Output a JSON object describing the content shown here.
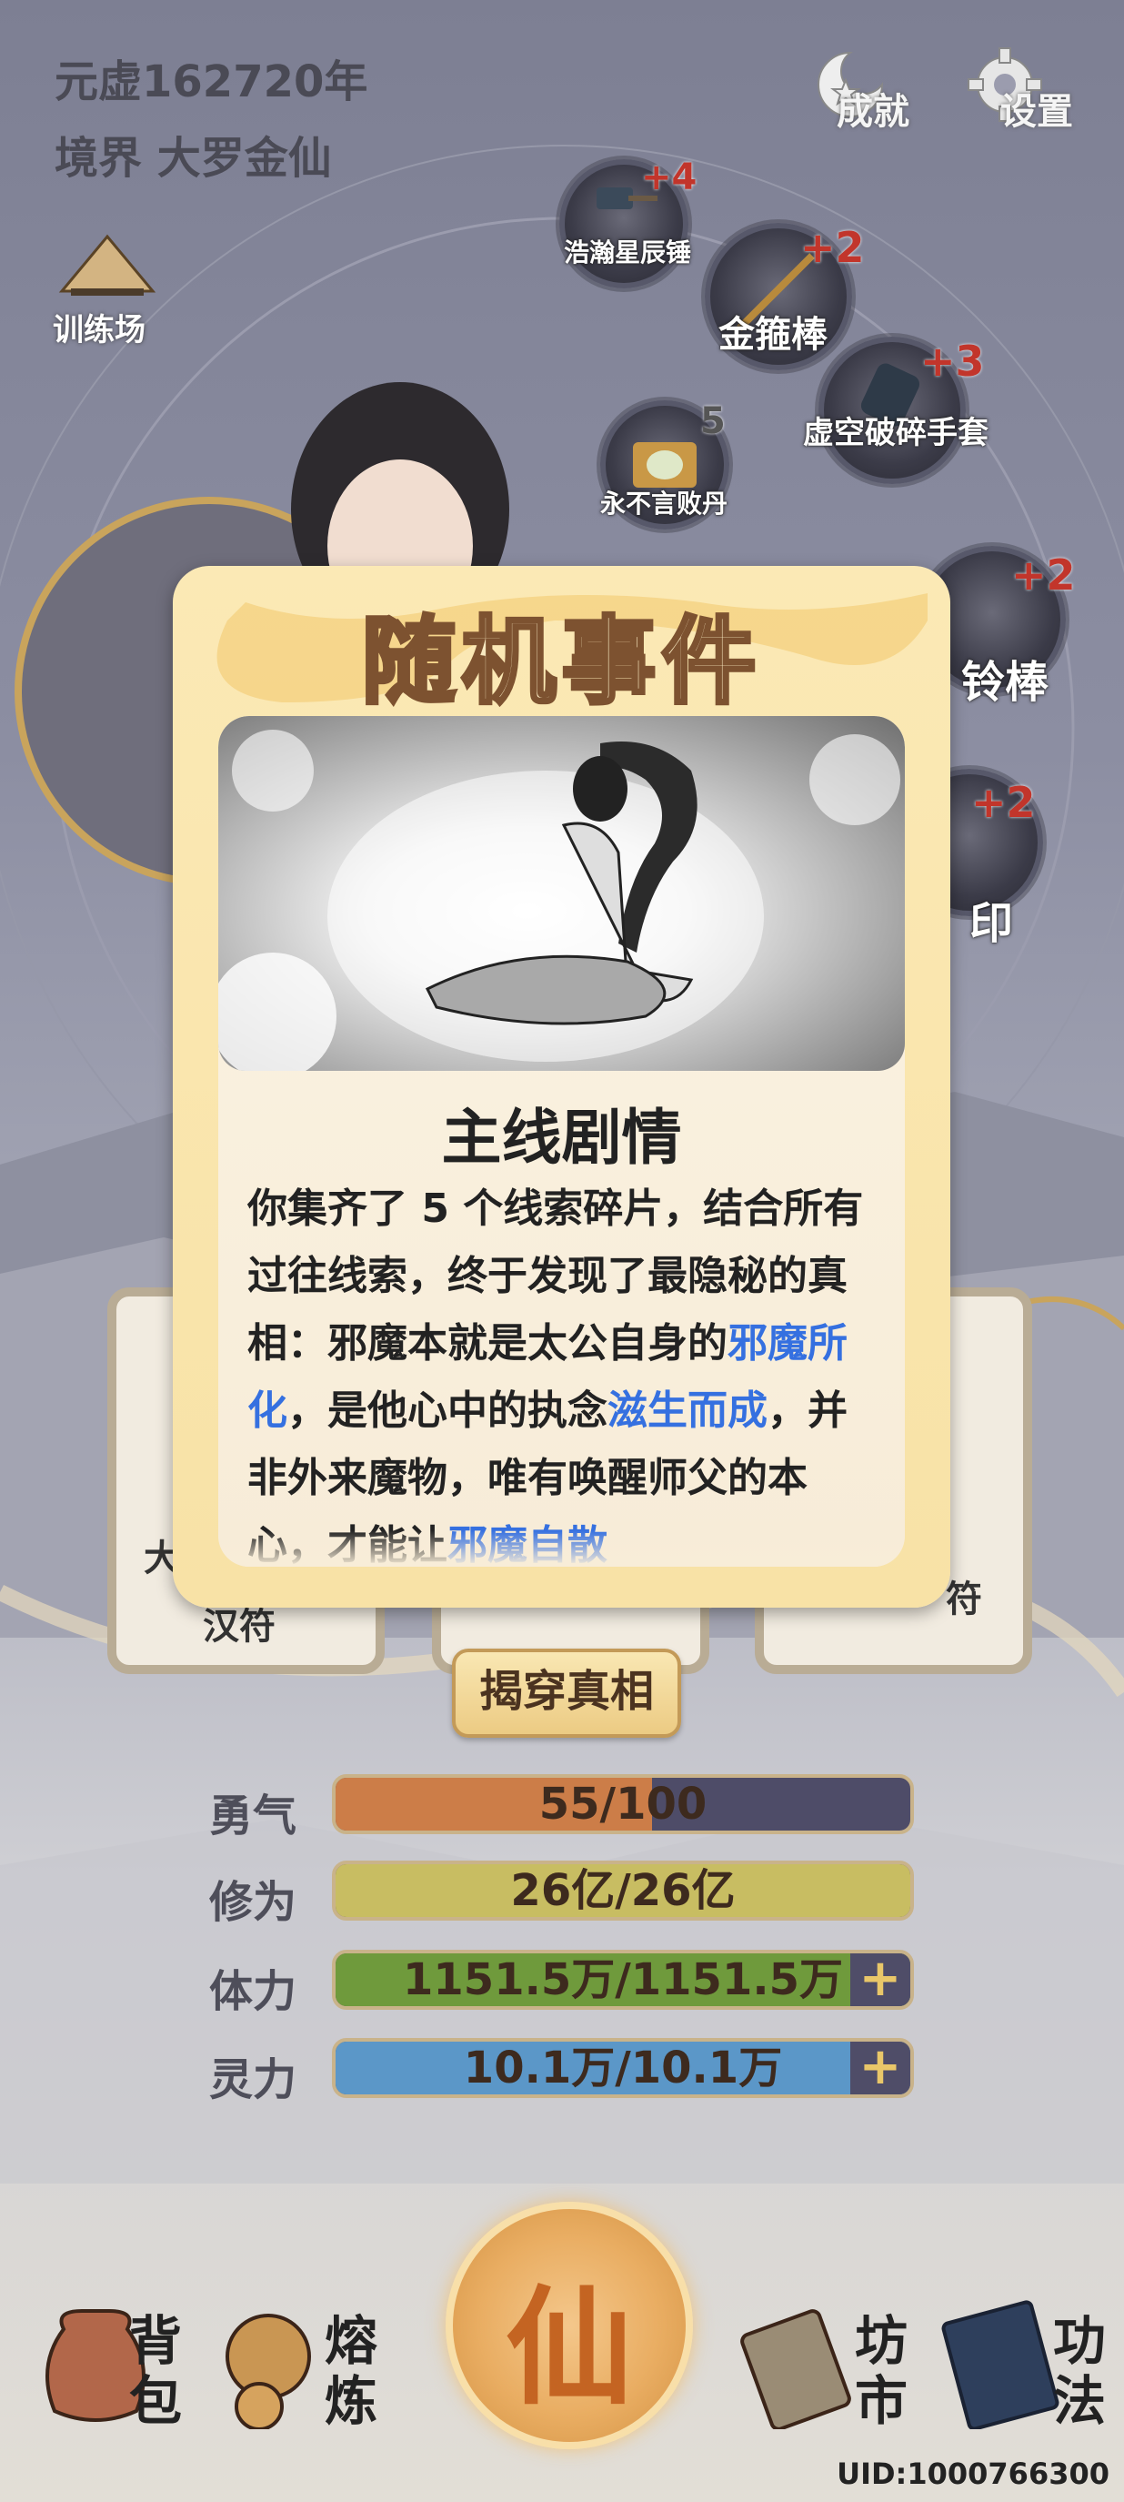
{
  "header": {
    "year": "元虚162720年",
    "realm": "境界 大罗金仙",
    "achievements_label": "成就",
    "settings_label": "设置",
    "training_label": "训练场"
  },
  "skill_nodes": [
    {
      "name": "浩瀚星辰锤",
      "plus": "+4"
    },
    {
      "name": "金箍棒",
      "plus": "+2"
    },
    {
      "name": "虚空破碎手套",
      "plus": "+3"
    },
    {
      "name": "永不言败丹",
      "plus": "5"
    },
    {
      "name": "铃棒",
      "plus": "+2"
    },
    {
      "name": "印",
      "plus": "+2"
    }
  ],
  "cards": {
    "left_partial_top": "大",
    "left_partial_bottom": "汉符",
    "right_partial": "符"
  },
  "modal": {
    "title": "随机事件",
    "story_title": "主线剧情",
    "text_1": "你集齐了 5 个线索碎片，结合所有过往线索，终于发现了最隐秘的真相：邪魔本就是太公自身的",
    "hl_1": "邪魔所化",
    "text_2": "，是他心中的执念",
    "hl_2": "滋生而成",
    "text_3": "，并非外来魔物，唯有唤醒师父的本心，才能让",
    "hl_3": "邪魔自散"
  },
  "reveal_button": "揭穿真相",
  "stats": [
    {
      "label": "勇气",
      "value": "55/100",
      "ratio": 0.55,
      "color": "#cc7d48",
      "has_plus": false
    },
    {
      "label": "修为",
      "value": "26亿/26亿",
      "ratio": 1.0,
      "color": "#c8bd62",
      "has_plus": false
    },
    {
      "label": "体力",
      "value": "1151.5万/1151.5万",
      "ratio": 1.0,
      "color": "#6f9a3c",
      "has_plus": true
    },
    {
      "label": "灵力",
      "value": "10.1万/10.1万",
      "ratio": 1.0,
      "color": "#5b97c8",
      "has_plus": true
    }
  ],
  "bottom_nav": {
    "bag": "背包",
    "smelt": "熔炼",
    "center": "仙",
    "market": "坊市",
    "skills": "功法"
  },
  "uid": "UID:1000766300",
  "icons": [
    "achievement-icon",
    "settings-gear-icon",
    "straw-hat-icon",
    "hammer-icon",
    "staff-icon",
    "glove-icon",
    "elixir-icon",
    "bag-icon",
    "smelt-icon",
    "scroll-icon",
    "book-icon"
  ]
}
